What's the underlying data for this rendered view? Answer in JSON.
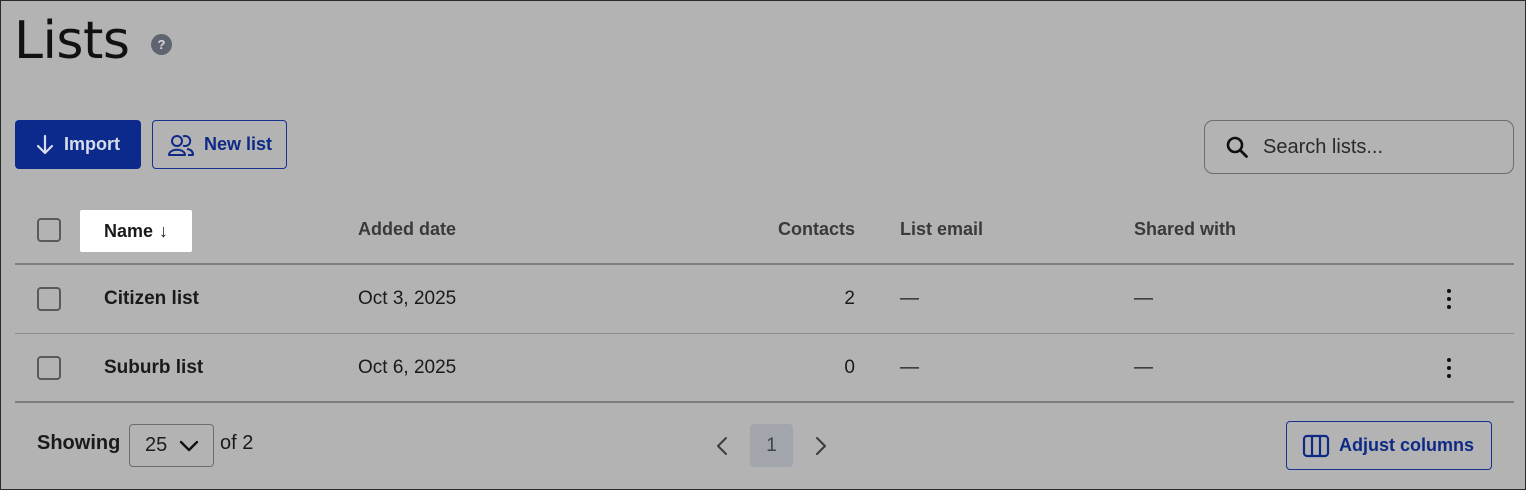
{
  "page": {
    "title": "Lists",
    "help_icon": "?"
  },
  "toolbar": {
    "import_label": "Import",
    "new_list_label": "New list",
    "search_placeholder": "Search lists..."
  },
  "table": {
    "columns": [
      "Name",
      "Added date",
      "Contacts",
      "List email",
      "Shared with"
    ],
    "sort_indicator": "↓",
    "rows": [
      {
        "name": "Citizen list",
        "added_date": "Oct 3, 2025",
        "contacts": "2",
        "list_email": "—",
        "shared_with": "—"
      },
      {
        "name": "Suburb list",
        "added_date": "Oct 6, 2025",
        "contacts": "0",
        "list_email": "—",
        "shared_with": "—"
      }
    ]
  },
  "footer": {
    "showing_label": "Showing",
    "page_size": "25",
    "of_total": "of 2",
    "current_page": "1",
    "adjust_columns_label": "Adjust columns"
  },
  "colors": {
    "background": "#b3b3b3",
    "primary": "#0b2a8c",
    "outline": "#18308e"
  }
}
